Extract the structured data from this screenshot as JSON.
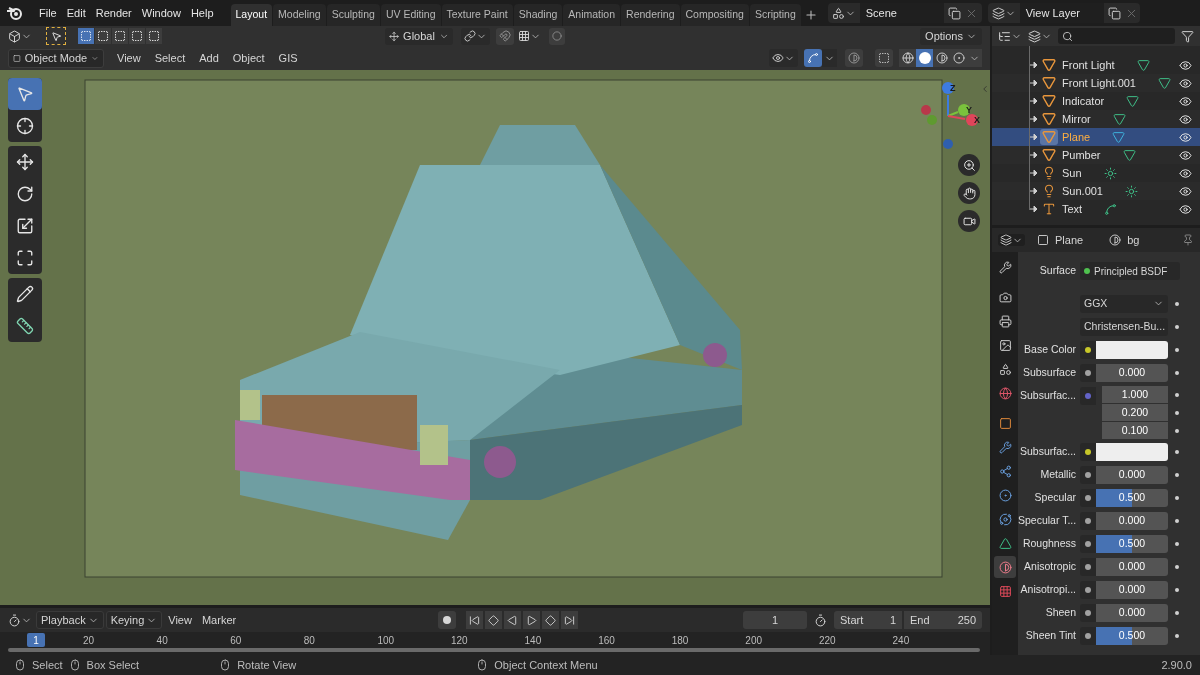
{
  "menu": [
    "File",
    "Edit",
    "Render",
    "Window",
    "Help"
  ],
  "workspace_tabs": [
    {
      "label": "Layout",
      "selected": true
    },
    {
      "label": "Modeling",
      "selected": false
    },
    {
      "label": "Sculpting",
      "selected": false
    },
    {
      "label": "UV Editing",
      "selected": false
    },
    {
      "label": "Texture Paint",
      "selected": false
    },
    {
      "label": "Shading",
      "selected": false
    },
    {
      "label": "Animation",
      "selected": false
    },
    {
      "label": "Rendering",
      "selected": false
    },
    {
      "label": "Compositing",
      "selected": false
    },
    {
      "label": "Scripting",
      "selected": false
    }
  ],
  "scene": "Scene",
  "view_layer": "View Layer",
  "tool_header": {
    "select_modes": [
      {
        "selected": true
      },
      {
        "selected": false
      },
      {
        "selected": false
      },
      {
        "selected": false
      },
      {
        "selected": false
      }
    ],
    "orientation": "Global",
    "options": "Options"
  },
  "viewport_header": {
    "mode": "Object Mode",
    "menus": [
      "View",
      "Select",
      "Add",
      "Object",
      "GIS"
    ],
    "gizmos_on": true,
    "shading_modes": [
      {
        "kind": "wireframe",
        "selected": false
      },
      {
        "kind": "solid",
        "selected": true
      },
      {
        "kind": "material",
        "selected": false
      },
      {
        "kind": "rendered",
        "selected": false
      }
    ]
  },
  "toolbar": [
    {
      "kind": "select",
      "selected": true
    },
    {
      "kind": "cursor",
      "selected": false
    },
    {
      "kind": "move",
      "selected": false
    },
    {
      "kind": "rotate",
      "selected": false
    },
    {
      "kind": "scale",
      "selected": false
    },
    {
      "kind": "transform",
      "selected": false
    },
    {
      "kind": "annotate",
      "selected": false
    },
    {
      "kind": "measure",
      "selected": false
    }
  ],
  "gizmo": {
    "axes": [
      "Z",
      "Y",
      "X"
    ]
  },
  "outliner": {
    "items": [
      {
        "name": "Front Light",
        "kind": "mesh",
        "selected": false
      },
      {
        "name": "Front Light.001",
        "kind": "mesh",
        "selected": false
      },
      {
        "name": "Indicator",
        "kind": "mesh",
        "selected": false
      },
      {
        "name": "Mirror",
        "kind": "mesh",
        "selected": false
      },
      {
        "name": "Plane",
        "kind": "mesh",
        "selected": true
      },
      {
        "name": "Pumber",
        "kind": "mesh",
        "selected": false
      },
      {
        "name": "Sun",
        "kind": "light",
        "selected": false
      },
      {
        "name": "Sun.001",
        "kind": "light",
        "selected": false
      },
      {
        "name": "Text",
        "kind": "text",
        "selected": false
      }
    ]
  },
  "properties": {
    "object": "Plane",
    "material": "bg",
    "tabs": [
      {
        "kind": "tool",
        "selected": false
      },
      {
        "kind": "render",
        "selected": false
      },
      {
        "kind": "output",
        "selected": false
      },
      {
        "kind": "view_layer",
        "selected": false
      },
      {
        "kind": "scene",
        "selected": false
      },
      {
        "kind": "world",
        "selected": false
      },
      {
        "kind": "object",
        "selected": false
      },
      {
        "kind": "modifiers",
        "selected": false
      },
      {
        "kind": "particles",
        "selected": false
      },
      {
        "kind": "physics",
        "selected": false
      },
      {
        "kind": "constraints",
        "selected": false
      },
      {
        "kind": "data",
        "selected": false
      },
      {
        "kind": "material",
        "selected": true
      },
      {
        "kind": "texture",
        "selected": false
      }
    ],
    "rows": [
      {
        "kind": "shader",
        "label": "Surface",
        "value": "Principled BSDF",
        "color": "#4fc14f"
      },
      {
        "kind": "dropdown",
        "value": "GGX"
      },
      {
        "kind": "dropdown",
        "value": "Christensen-Bu..."
      },
      {
        "kind": "color",
        "label": "Base Color",
        "color": "#c7c729"
      },
      {
        "kind": "slider",
        "label": "Subsurface",
        "value": "0.000",
        "level": 0,
        "color": "#a1a1a1"
      },
      {
        "kind": "vector",
        "label": "Subsurfac...",
        "values": [
          "1.000",
          "0.200",
          "0.100"
        ],
        "color": "#6363c7"
      },
      {
        "kind": "color",
        "label": "Subsurfac...",
        "color": "#c7c729"
      },
      {
        "kind": "slider",
        "label": "Metallic",
        "value": "0.000",
        "level": 0,
        "color": "#a1a1a1"
      },
      {
        "kind": "slider",
        "label": "Specular",
        "value": "0.500",
        "level": 0.5,
        "color": "#a1a1a1"
      },
      {
        "kind": "slider",
        "label": "Specular T...",
        "value": "0.000",
        "level": 0,
        "color": "#a1a1a1"
      },
      {
        "kind": "slider",
        "label": "Roughness",
        "value": "0.500",
        "level": 0.5,
        "color": "#a1a1a1"
      },
      {
        "kind": "slider",
        "label": "Anisotropic",
        "value": "0.000",
        "level": 0,
        "color": "#a1a1a1"
      },
      {
        "kind": "slider",
        "label": "Anisotropi...",
        "value": "0.000",
        "level": 0,
        "color": "#a1a1a1"
      },
      {
        "kind": "slider",
        "label": "Sheen",
        "value": "0.000",
        "level": 0,
        "color": "#a1a1a1"
      },
      {
        "kind": "slider",
        "label": "Sheen Tint",
        "value": "0.500",
        "level": 0.5,
        "color": "#a1a1a1"
      }
    ]
  },
  "timeline": {
    "menus": [
      {
        "label": "Playback",
        "dropdown": true
      },
      {
        "label": "Keying",
        "dropdown": true
      },
      {
        "label": "View",
        "dropdown": false
      },
      {
        "label": "Marker",
        "dropdown": false
      }
    ],
    "current_frame": "1",
    "start_label": "Start",
    "start": "1",
    "end_label": "End",
    "end": "250",
    "playhead": "1",
    "ticks": [
      "20",
      "40",
      "60",
      "80",
      "100",
      "120",
      "140",
      "160",
      "180",
      "200",
      "220",
      "240"
    ]
  },
  "status_bar": {
    "hints": [
      {
        "kind": "left",
        "label": "Select"
      },
      {
        "kind": "middle",
        "label": "Box Select"
      },
      {
        "kind": "middle",
        "label": "Rotate View"
      },
      {
        "kind": "right",
        "label": "Object Context Menu"
      }
    ],
    "version": "2.90.0"
  }
}
